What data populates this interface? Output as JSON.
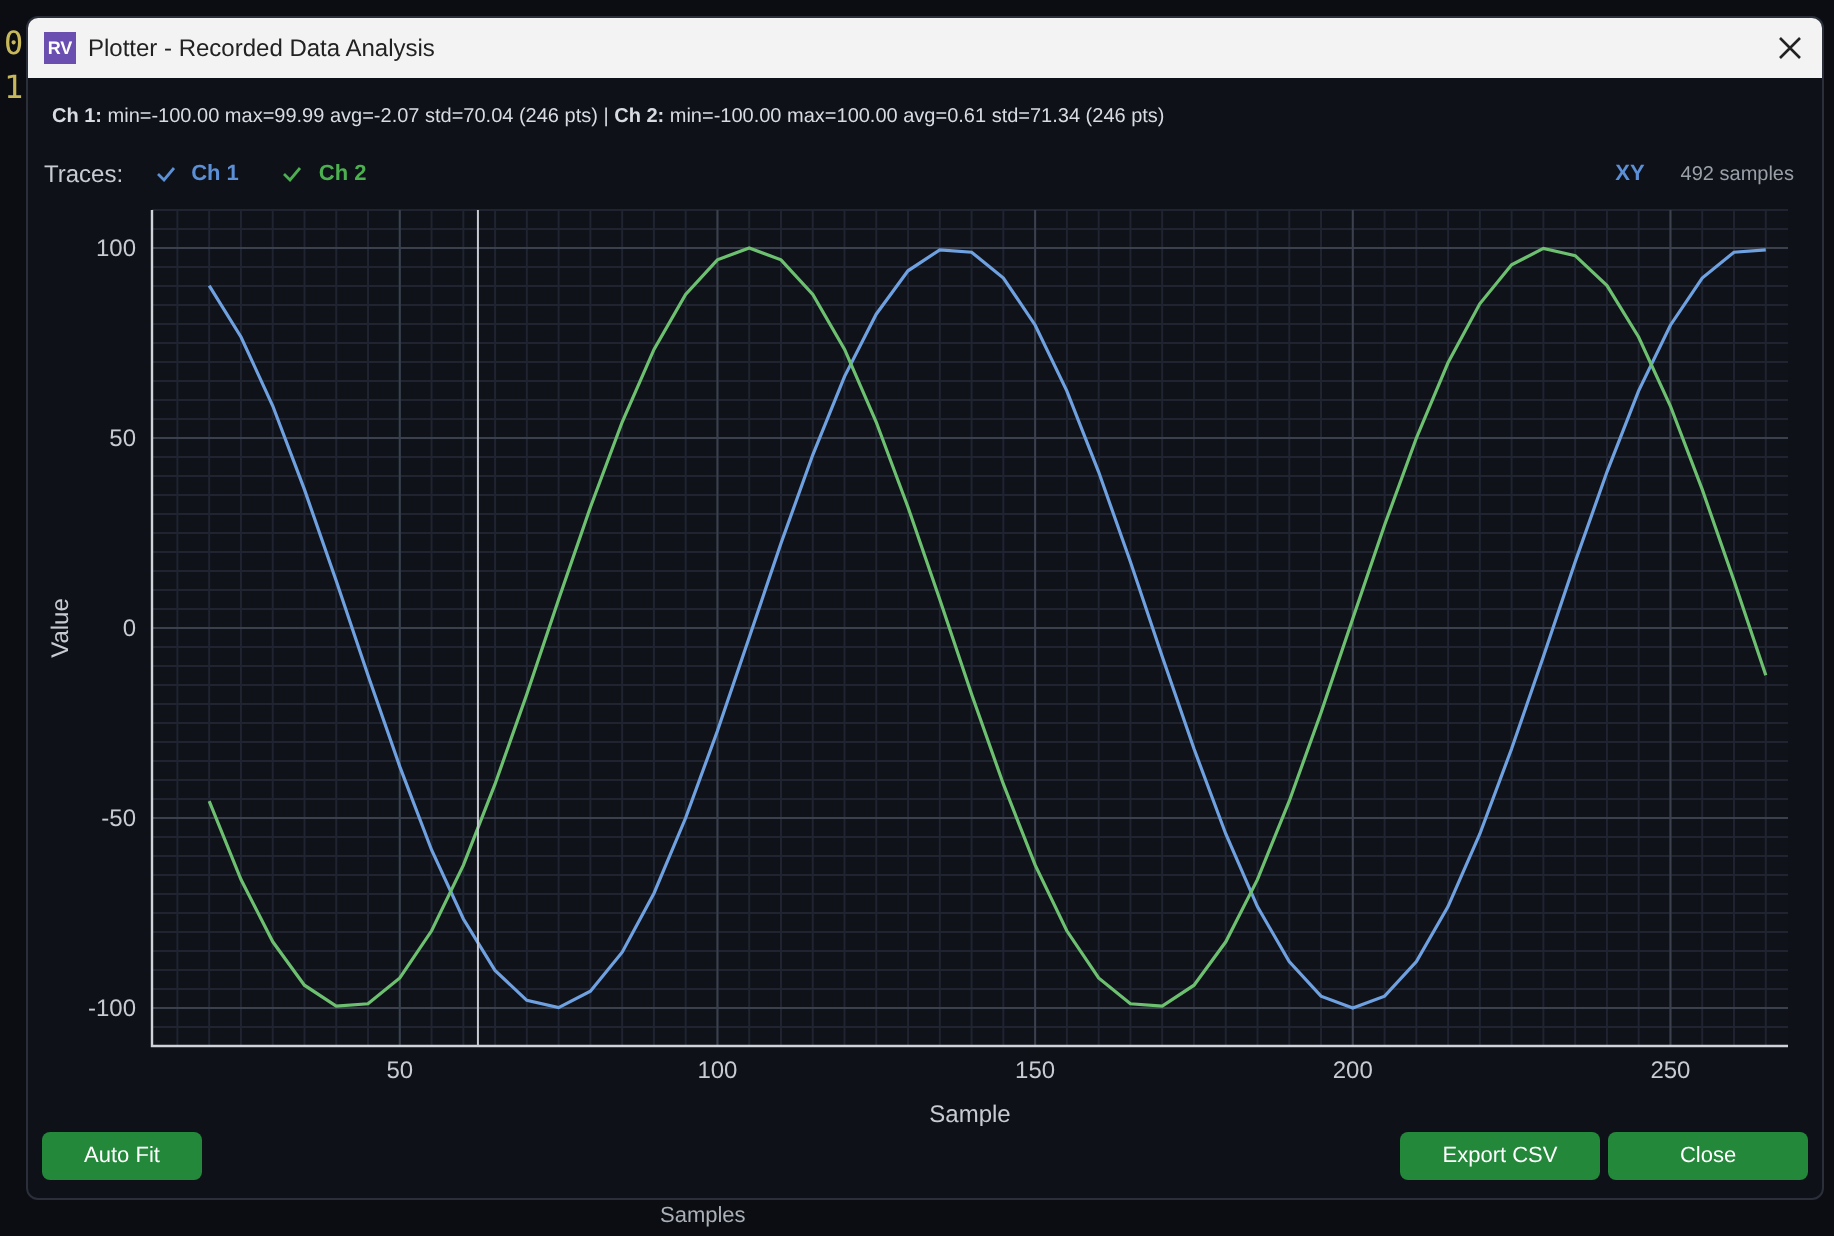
{
  "background": {
    "line_digits": [
      "0",
      "1"
    ],
    "axis_label": "Samples"
  },
  "window": {
    "title": "Plotter - Recorded Data Analysis",
    "logo": "RV"
  },
  "stats": "**Ch 1:** min=-100.00 max=99.99 avg=-2.07 std=70.04 (246 pts) | **Ch 2:** min=-100.00 max=100.00 avg=0.61 std=71.34 (246 pts)",
  "traces": {
    "label": "Traces:",
    "items": [
      {
        "name": "Ch 1",
        "checked": true,
        "color": "#5b8fd6"
      },
      {
        "name": "Ch 2",
        "checked": true,
        "color": "#4caf50"
      }
    ],
    "mode": "XY",
    "sample_count": "492 samples"
  },
  "chart_data": {
    "type": "line",
    "xlabel": "Sample",
    "ylabel": "Value",
    "xlim": [
      11,
      268.5
    ],
    "ylim": [
      -110,
      110
    ],
    "xticks": [
      50,
      100,
      150,
      200,
      250
    ],
    "yticks": [
      -100,
      -50,
      0,
      50,
      100
    ],
    "x": [
      20,
      25,
      30,
      35,
      40,
      45,
      50,
      55,
      60,
      65,
      70,
      75,
      80,
      85,
      90,
      95,
      100,
      105,
      110,
      115,
      120,
      125,
      130,
      135,
      140,
      145,
      150,
      155,
      160,
      165,
      170,
      175,
      180,
      185,
      190,
      195,
      200,
      205,
      210,
      215,
      220,
      225,
      230,
      235,
      240,
      245,
      250,
      255,
      260,
      265
    ],
    "series": [
      {
        "color": "#6fa0e0",
        "values": [
          90.1,
          76.6,
          58.4,
          36.5,
          12.4,
          -12.4,
          -36.5,
          -58.4,
          -76.6,
          -90.1,
          -98.0,
          -99.9,
          -95.6,
          -85.3,
          -69.8,
          -50.0,
          -27.1,
          -2.5,
          22.3,
          45.6,
          66.2,
          82.6,
          94.0,
          99.5,
          98.9,
          92.1,
          79.7,
          62.4,
          41.1,
          17.4,
          -7.5,
          -31.8,
          -54.2,
          -73.3,
          -87.8,
          -96.9,
          -100.0,
          -96.9,
          -87.8,
          -73.3,
          -54.2,
          -31.8,
          -7.5,
          17.4,
          41.1,
          62.4,
          79.7,
          92.1,
          98.9,
          99.5
        ]
      },
      {
        "color": "#6cc070",
        "values": [
          -45.6,
          -66.2,
          -82.6,
          -94.0,
          -99.5,
          -98.9,
          -92.1,
          -79.7,
          -62.4,
          -41.1,
          -17.4,
          7.5,
          31.8,
          54.2,
          73.3,
          87.8,
          96.9,
          100.0,
          96.9,
          87.8,
          73.3,
          54.2,
          31.8,
          7.5,
          -17.4,
          -41.1,
          -62.4,
          -79.7,
          -92.1,
          -98.9,
          -99.5,
          -94.0,
          -82.6,
          -66.2,
          -45.6,
          -22.3,
          2.5,
          27.1,
          50.0,
          69.8,
          85.3,
          95.6,
          99.9,
          98.0,
          90.1,
          76.6,
          58.4,
          36.5,
          12.4,
          -12.4
        ]
      }
    ],
    "grid": true,
    "ref_lines": [
      {
        "axis": "x",
        "value": 62.3
      }
    ]
  },
  "buttons": {
    "left": [
      {
        "label": "Auto Fit"
      }
    ],
    "right": [
      {
        "label": "Export CSV"
      },
      {
        "label": "Close"
      }
    ]
  }
}
